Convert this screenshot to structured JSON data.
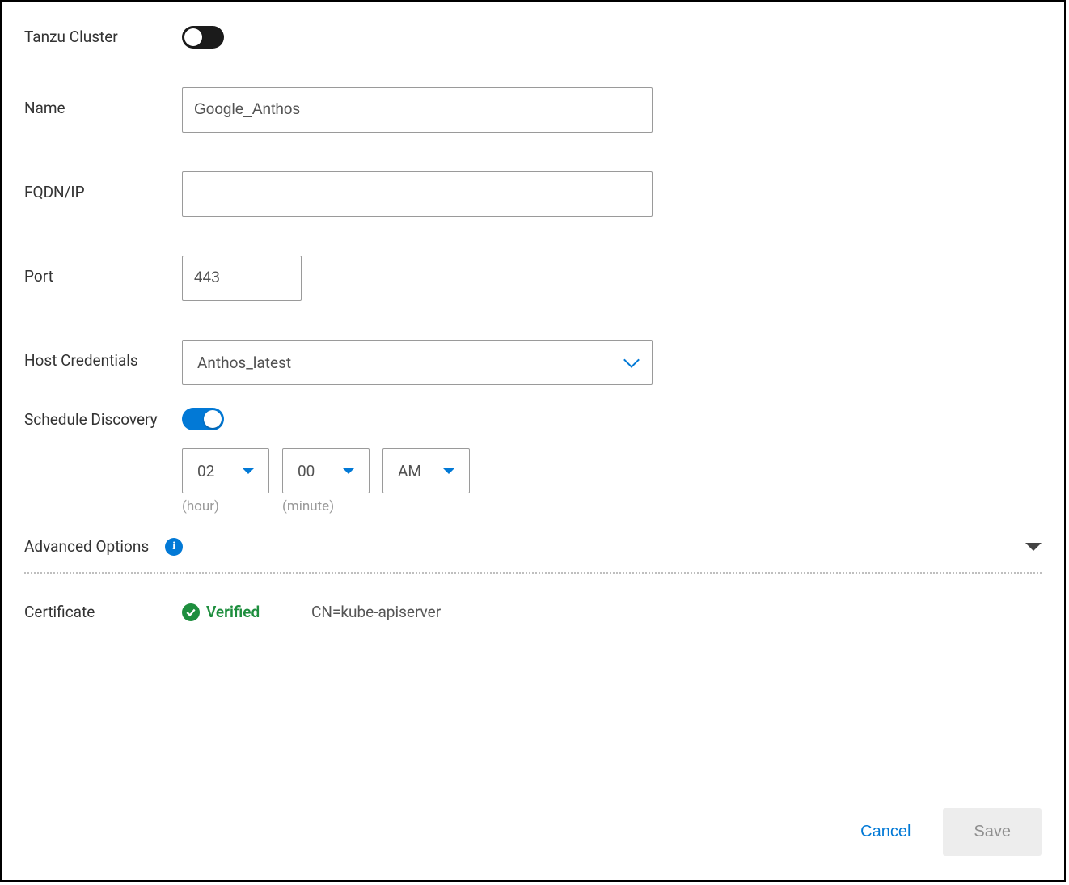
{
  "fields": {
    "tanzu_cluster": {
      "label": "Tanzu Cluster",
      "enabled": false
    },
    "name": {
      "label": "Name",
      "value": "Google_Anthos"
    },
    "fqdn": {
      "label": "FQDN/IP",
      "value": ""
    },
    "port": {
      "label": "Port",
      "value": "443"
    },
    "host_credentials": {
      "label": "Host Credentials",
      "selected": "Anthos_latest"
    },
    "schedule_discovery": {
      "label": "Schedule Discovery",
      "enabled": true,
      "hour": {
        "value": "02",
        "caption": "(hour)"
      },
      "minute": {
        "value": "00",
        "caption": "(minute)"
      },
      "ampm": {
        "value": "AM"
      }
    },
    "advanced_options": {
      "label": "Advanced Options"
    },
    "certificate": {
      "label": "Certificate",
      "status": "Verified",
      "detail": "CN=kube-apiserver"
    }
  },
  "footer": {
    "cancel": "Cancel",
    "save": "Save"
  }
}
